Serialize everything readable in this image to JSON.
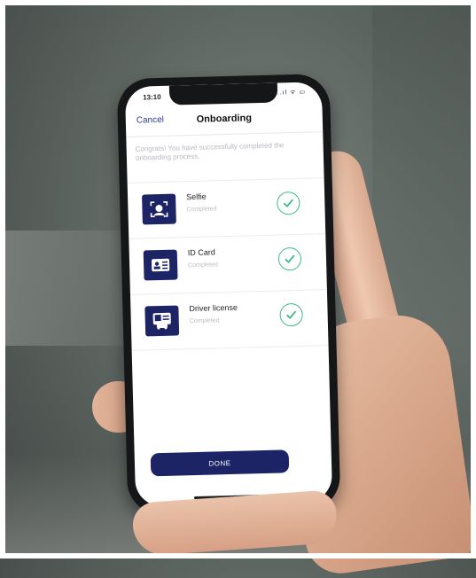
{
  "status_bar": {
    "time": "13:10",
    "icons": "..ıl ᯤ ▭"
  },
  "nav": {
    "cancel_label": "Cancel",
    "title": "Onboarding"
  },
  "message": "Congrats! You have successfully completed the onboarding process.",
  "steps": [
    {
      "label": "Selfie",
      "status": "Completed",
      "icon": "selfie-face-icon"
    },
    {
      "label": "ID Card",
      "status": "Completed",
      "icon": "id-card-icon"
    },
    {
      "label": "Driver license",
      "status": "Completed",
      "icon": "driver-license-icon"
    }
  ],
  "done_label": "DONE",
  "colors": {
    "accent": "#1d2466",
    "success": "#3dbb84",
    "cancel": "#2f3a8c"
  }
}
